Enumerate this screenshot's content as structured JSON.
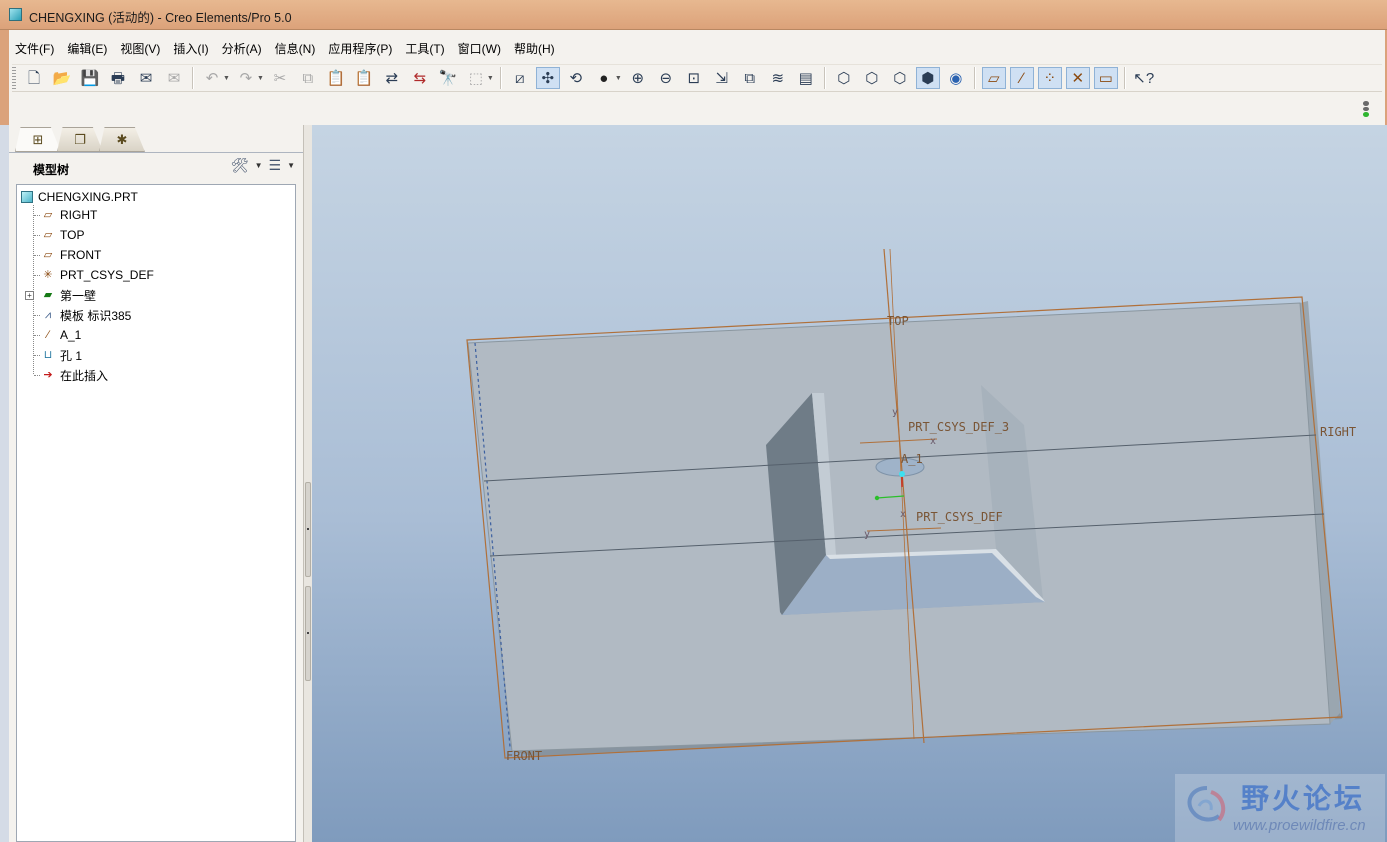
{
  "window": {
    "title": "CHENGXING (活动的) - Creo Elements/Pro 5.0"
  },
  "menubar": {
    "items": [
      "文件(F)",
      "编辑(E)",
      "视图(V)",
      "插入(I)",
      "分析(A)",
      "信息(N)",
      "应用程序(P)",
      "工具(T)",
      "窗口(W)",
      "帮助(H)"
    ]
  },
  "toolbar": {
    "icons": [
      "new-icon",
      "open-icon",
      "save-icon",
      "print-icon",
      "email-icon",
      "email-link-icon",
      "undo-icon",
      "redo-icon",
      "cut-icon",
      "copy-icon",
      "paste-icon",
      "paste-special-icon",
      "regenerate-icon",
      "regen-manager-icon",
      "find-icon",
      "select-box-icon",
      "redraw-icon",
      "spin-center-icon",
      "orient-mode-icon",
      "shading-icon",
      "zoom-in-icon",
      "zoom-out-icon",
      "refit-icon",
      "reorient-icon",
      "saved-views-icon",
      "layers-icon",
      "view-manager-icon",
      "wireframe-icon",
      "hidden-line-icon",
      "no-hidden-icon",
      "shaded-icon",
      "enhanced-realism-icon",
      "datum-planes-icon",
      "datum-axes-icon",
      "datum-points-icon",
      "csys-icon",
      "annotation-icon",
      "context-help-icon"
    ]
  },
  "model_tree": {
    "tabs": [
      "model-tree-tab",
      "layers-tab",
      "favorites-tab"
    ],
    "title": "模型树",
    "root": "CHENGXING.PRT",
    "items": [
      {
        "label": "RIGHT",
        "icon": "datum-plane-icon"
      },
      {
        "label": "TOP",
        "icon": "datum-plane-icon"
      },
      {
        "label": "FRONT",
        "icon": "datum-plane-icon"
      },
      {
        "label": "PRT_CSYS_DEF",
        "icon": "csys-icon"
      },
      {
        "label": "第一壁",
        "icon": "sheetmetal-wall-icon"
      },
      {
        "label": "模板 标识385",
        "icon": "form-icon"
      },
      {
        "label": "A_1",
        "icon": "datum-axis-icon"
      },
      {
        "label": "孔 1",
        "icon": "hole-icon"
      },
      {
        "label": "在此插入",
        "icon": "insert-here-icon"
      }
    ]
  },
  "viewport": {
    "datum_labels": {
      "top": "TOP",
      "right": "RIGHT",
      "front": "FRONT",
      "csys3": "PRT_CSYS_DEF_3",
      "csys": "PRT_CSYS_DEF",
      "axis": "A_1",
      "x": "x",
      "y": "y"
    }
  },
  "watermark": {
    "name": "野火论坛",
    "url": "www.proewildfire.cn"
  },
  "colors": {
    "datum": "#b0703a",
    "part_face": "#b1bac3",
    "part_edge": "#8a969f",
    "wall_shade": "#6f7c87",
    "wall_light": "#c3ccd4"
  }
}
